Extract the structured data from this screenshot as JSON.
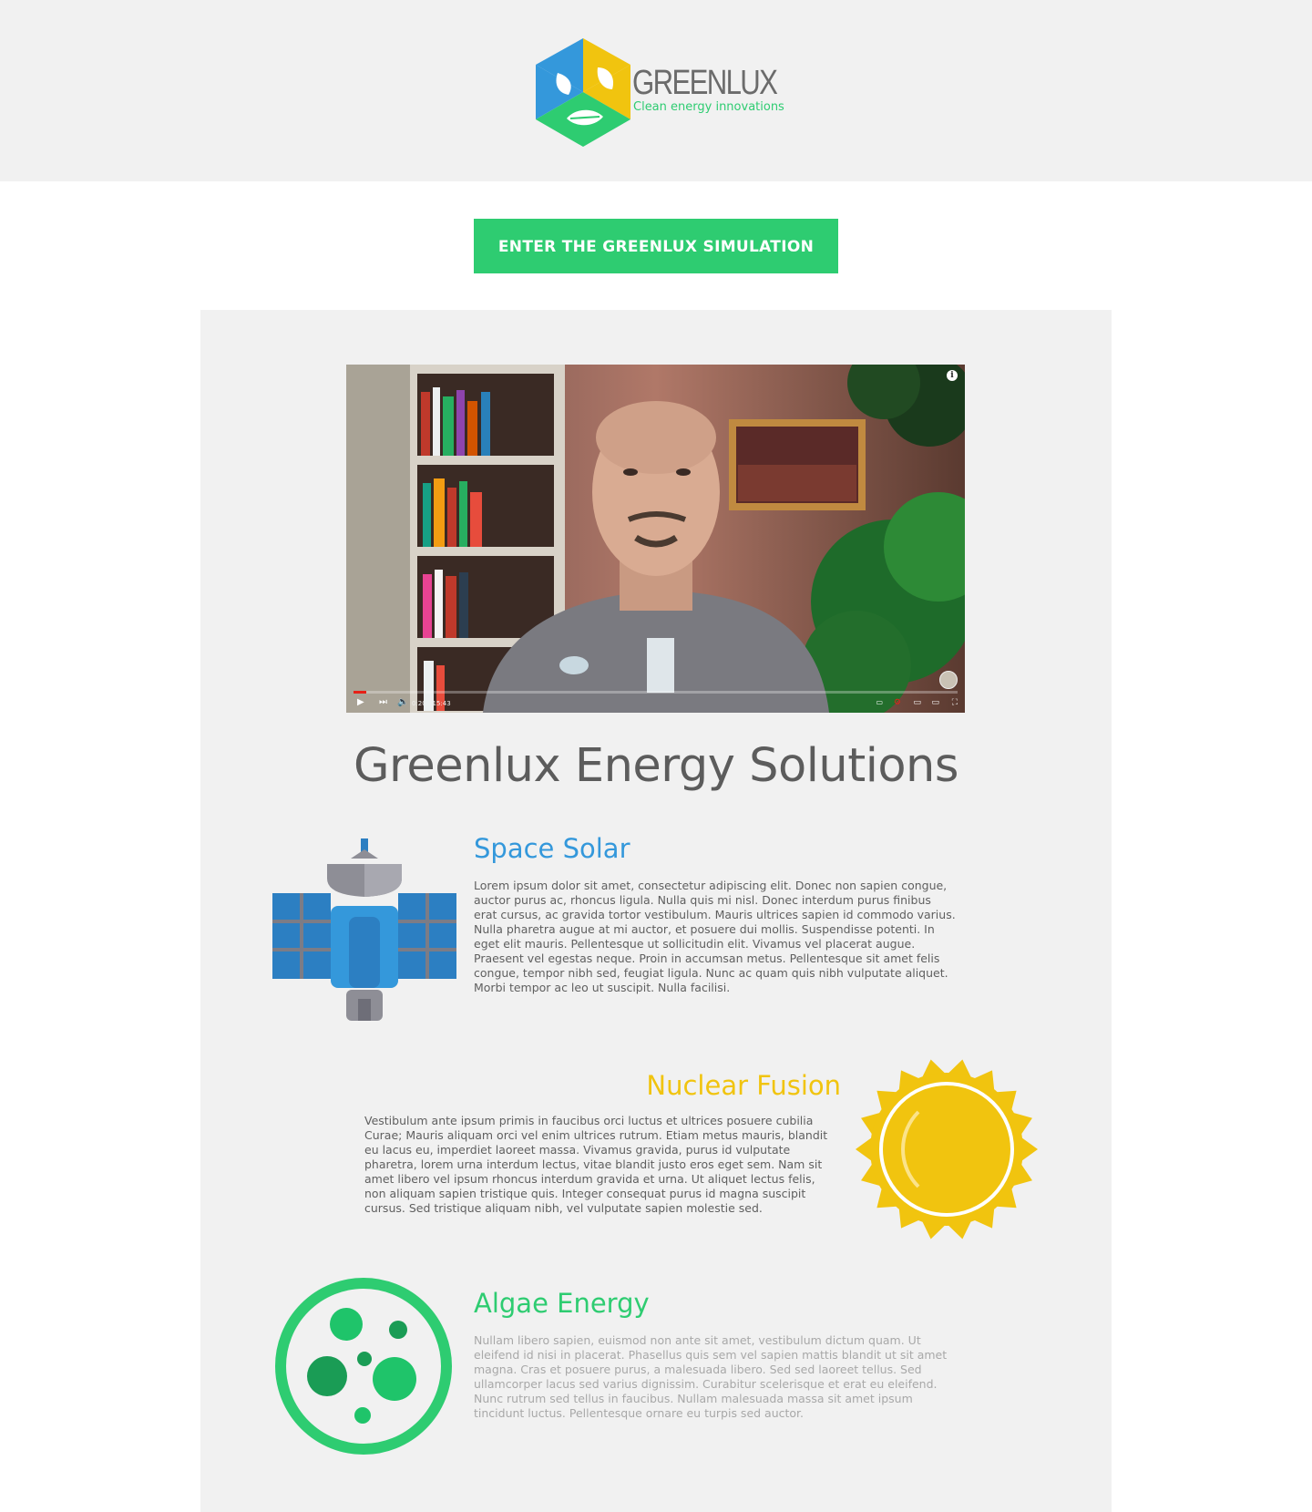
{
  "brand": {
    "name": "GREENLUX",
    "tagline": "Clean energy innovations"
  },
  "cta": {
    "label": "ENTER THE GREENLUX SIMULATION"
  },
  "video": {
    "time": "0:20 / 15:43",
    "progress": 0.021
  },
  "main_title": "Greenlux Energy Solutions",
  "features": [
    {
      "title": "Space Solar",
      "icon": "satellite-icon",
      "color": "#3498db",
      "text": "Lorem ipsum dolor sit amet, consectetur adipiscing elit. Donec non sapien congue, auctor purus ac, rhoncus ligula. Nulla quis mi nisl. Donec interdum purus finibus erat cursus, ac gravida tortor vestibulum. Mauris ultrices sapien id commodo varius. Nulla pharetra augue at mi auctor, et posuere dui mollis. Suspendisse potenti. In eget elit mauris. Pellentesque ut sollicitudin elit. Vivamus vel placerat augue. Praesent vel egestas neque. Proin in accumsan metus. Pellentesque sit amet felis congue, tempor nibh sed, feugiat ligula. Nunc ac quam quis nibh vulputate aliquet. Morbi tempor ac leo ut suscipit. Nulla facilisi."
    },
    {
      "title": "Nuclear Fusion",
      "icon": "sun-icon",
      "color": "#f1c40f",
      "text": "Vestibulum ante ipsum primis in faucibus orci luctus et ultrices posuere cubilia Curae; Mauris aliquam orci vel enim ultrices rutrum. Etiam metus mauris, blandit eu lacus eu, imperdiet laoreet massa. Vivamus gravida, purus id vulputate pharetra, lorem urna interdum lectus, vitae blandit justo eros eget sem. Nam sit amet libero vel ipsum rhoncus interdum gravida et urna. Ut aliquet lectus felis, non aliquam sapien tristique quis. Integer consequat purus id magna suscipit cursus. Sed tristique aliquam nibh, vel vulputate sapien molestie sed."
    },
    {
      "title": "Algae Energy",
      "icon": "algae-cell-icon",
      "color": "#2ecc71",
      "text": "Nullam libero sapien, euismod non ante sit amet, vestibulum dictum quam. Ut eleifend id nisi in placerat. Phasellus quis sem vel sapien mattis blandit ut sit amet magna. Cras et posuere purus, a malesuada libero. Sed sed laoreet tellus. Sed ullamcorper lacus sed varius dignissim. Curabitur scelerisque et erat eu eleifend. Nunc rutrum sed tellus in faucibus. Nullam malesuada massa sit amet ipsum tincidunt luctus. Pellentesque ornare eu turpis sed auctor."
    }
  ]
}
